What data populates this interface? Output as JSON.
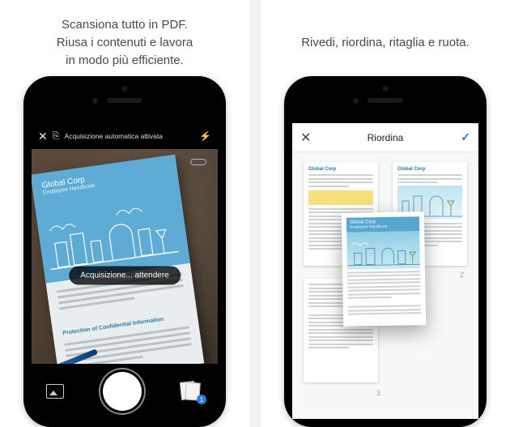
{
  "left": {
    "caption": "Scansiona tutto in PDF.\nRiusa i contenuti e lavora\nin modo più efficiente.",
    "topbar": {
      "auto_capture": "Acquisizione automatica attivata"
    },
    "doc": {
      "title": "Global Corp",
      "subtitle": "Employee Handbook",
      "section": "Protection of Confidential Information"
    },
    "toast": "Acquisizione... attendere",
    "badge_count": "1"
  },
  "right": {
    "caption": "Rivedi, riordina, ritaglia e ruota.",
    "title": "Riordina",
    "confirm": "✓",
    "close": "✕",
    "page2": "2",
    "page3": "3",
    "thumb_header": "Global Corp",
    "drag_title": "Global Corp",
    "drag_subtitle": "Employee Handbook"
  }
}
